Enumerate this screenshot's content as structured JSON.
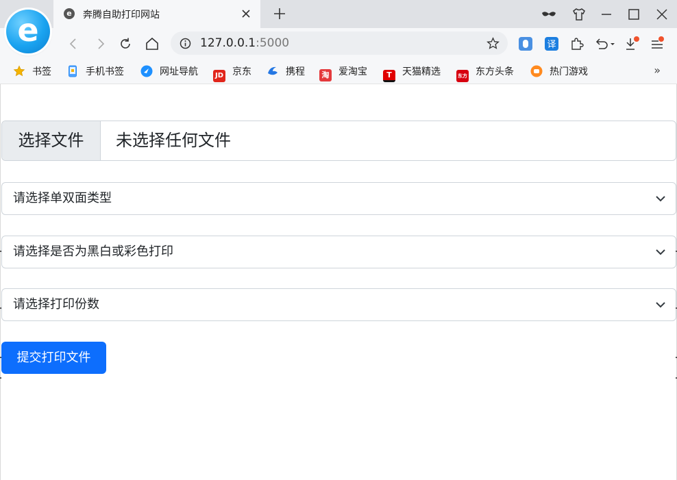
{
  "browser": {
    "tab": {
      "title": "奔腾自助打印网站",
      "favicon": "e"
    },
    "address": {
      "host": "127.0.0.1",
      "port": ":5000"
    },
    "bookmarks": [
      {
        "label": "书签",
        "icon": "star-icon",
        "color": "#f5b400"
      },
      {
        "label": "手机书签",
        "icon": "phone-icon",
        "color": "#2f8cf0"
      },
      {
        "label": "网址导航",
        "icon": "nav-icon",
        "color": "#1e90ff"
      },
      {
        "label": "京东",
        "icon": "jd-icon",
        "color": "#e1251b"
      },
      {
        "label": "携程",
        "icon": "ctrip-icon",
        "color": "#2577e3"
      },
      {
        "label": "爱淘宝",
        "icon": "taobao-icon",
        "color": "#e4393c"
      },
      {
        "label": "天猫精选",
        "icon": "tmall-icon",
        "color": "#e00000"
      },
      {
        "label": "东方头条",
        "icon": "dftt-icon",
        "color": "#d7000f"
      },
      {
        "label": "热门游戏",
        "icon": "game-icon",
        "color": "#ff8a1f"
      }
    ],
    "bookmarks_more": "»",
    "bookmark_glyphs": {
      "jd": "JD",
      "taobao": "淘",
      "tmall": "T",
      "dftt": "东方"
    }
  },
  "form": {
    "file": {
      "button_label": "选择文件",
      "status": "未选择任何文件"
    },
    "duplex_select": {
      "selected": "请选择单双面类型"
    },
    "color_select": {
      "selected": "请选择是否为黑白或彩色打印"
    },
    "copies_select": {
      "selected": "请选择打印份数"
    },
    "submit_label": "提交打印文件"
  },
  "colors": {
    "primary": "#0d6efd",
    "border": "#ced4da",
    "file_button_bg": "#e9ecef"
  }
}
